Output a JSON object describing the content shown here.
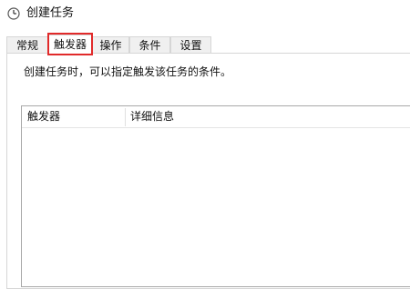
{
  "window": {
    "title": "创建任务",
    "icon": "clock-icon"
  },
  "tabs": [
    {
      "label": "常规",
      "active": false
    },
    {
      "label": "触发器",
      "active": true
    },
    {
      "label": "操作",
      "active": false
    },
    {
      "label": "条件",
      "active": false
    },
    {
      "label": "设置",
      "active": false
    }
  ],
  "triggers_tab": {
    "description": "创建任务时，可以指定触发该任务的条件。",
    "columns": [
      "触发器",
      "详细信息"
    ],
    "rows": []
  },
  "colors": {
    "highlight": "#e12a2a",
    "border": "#d6d6d6",
    "list_border": "#a8a8a8"
  }
}
